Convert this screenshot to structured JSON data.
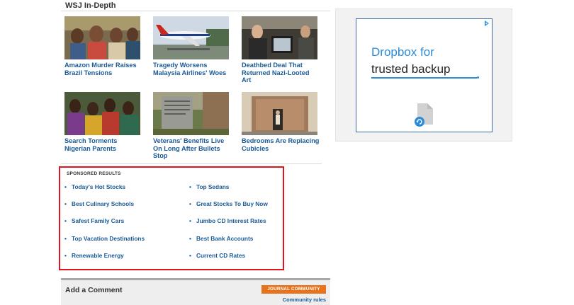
{
  "section": {
    "title": "WSJ In-Depth"
  },
  "stories": [
    {
      "headline": "Amazon Murder Raises Brazil Tensions",
      "image": "amazon-people-photo"
    },
    {
      "headline": "Tragedy Worsens Malaysia Airlines' Woes",
      "image": "malaysia-airlines-plane-photo"
    },
    {
      "headline": "Deathbed Deal That Returned Nazi-Looted Art",
      "image": "office-meeting-photo"
    },
    {
      "headline": "Search Torments Nigerian Parents",
      "image": "nigerian-women-photo"
    },
    {
      "headline": "Veterans' Benefits Live On Long After Bullets Stop",
      "image": "gravestone-photo"
    },
    {
      "headline": "Bedrooms Are Replacing Cubicles",
      "image": "bedroom-construction-photo"
    }
  ],
  "sponsored": {
    "title": "SPONSORED RESULTS",
    "left_links": [
      "Today's Hot Stocks",
      "Best Culinary Schools",
      "Safest Family Cars",
      "Top Vacation Destinations",
      "Renewable Energy"
    ],
    "right_links": [
      "Top Sedans",
      "Great Stocks To Buy Now",
      "Jumbo CD Interest Rates",
      "Best Bank Accounts",
      "Current CD Rates"
    ],
    "bullet": "•",
    "highlight_color": "#e0141e"
  },
  "comments": {
    "title": "Add a Comment",
    "badge": "JOURNAL COMMUNITY",
    "rules_link": "Community rules"
  },
  "ad": {
    "line1": "Dropbox for",
    "line2": "trusted backup",
    "choice_icon": "adchoices-icon",
    "file_icon": "file-sync-icon",
    "accent_color": "#2b8bd8"
  },
  "colors": {
    "link": "#1a5a96",
    "badge": "#e8731c"
  }
}
